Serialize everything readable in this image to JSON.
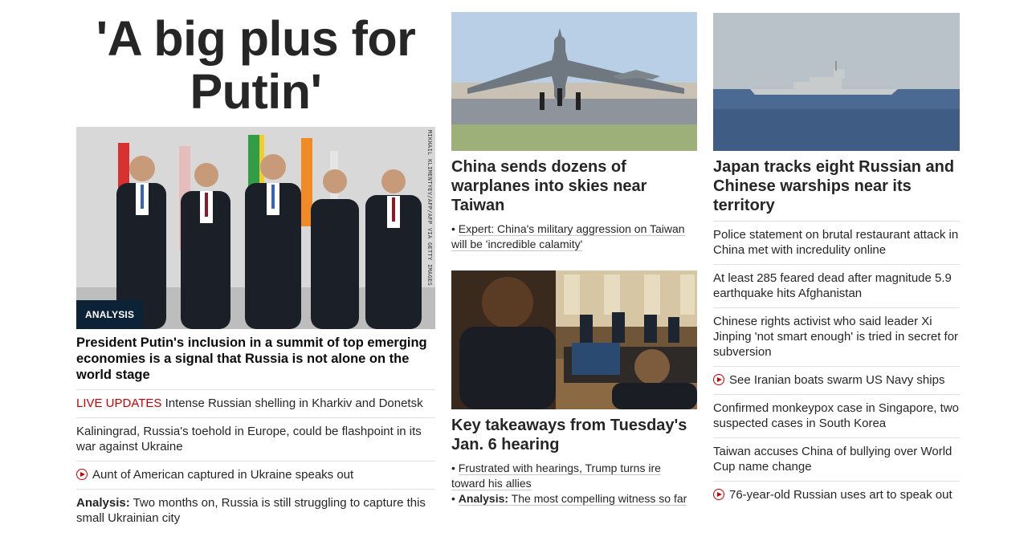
{
  "lead": {
    "headline": "'A big plus for Putin'",
    "image_credit": "MIKHAIL KLIMENTYEV/AFP/AFP VIA GETTY IMAGES",
    "badge": "ANALYSIS",
    "summary": "President Putin's inclusion in a summit of top emerging economies is a signal that Russia is not alone on the world stage"
  },
  "col1_list": [
    {
      "prefix": "LIVE UPDATES",
      "text": " Intense Russian shelling in Kharkiv and Donetsk"
    },
    {
      "text": "Kaliningrad, Russia's toehold in Europe, could be flashpoint in its war against Ukraine"
    },
    {
      "video": true,
      "text": "Aunt of American captured in Ukraine speaks out"
    },
    {
      "prefix": "Analysis:",
      "text": " Two months on, Russia is still struggling to capture this small Ukrainian city"
    }
  ],
  "col2": {
    "story1": {
      "headline": "China sends dozens of warplanes into skies near Taiwan",
      "sublinks": [
        {
          "text": "Expert: China's military aggression on Taiwan will be 'incredible calamity'"
        }
      ]
    },
    "story2": {
      "headline": "Key takeaways from Tuesday's Jan. 6 hearing",
      "sublinks": [
        {
          "text": "Frustrated with hearings, Trump turns ire toward his allies"
        },
        {
          "prefix": "Analysis:",
          "text": " The most compelling witness so far"
        }
      ]
    }
  },
  "col3": {
    "headline": "Japan tracks eight Russian and Chinese warships near its territory",
    "list": [
      {
        "text": "Police statement on brutal restaurant attack in China met with incredulity online"
      },
      {
        "text": "At least 285 feared dead after magnitude 5.9 earthquake hits Afghanistan"
      },
      {
        "text": "Chinese rights activist who said leader Xi Jinping 'not smart enough' is tried in secret for subversion"
      },
      {
        "video": true,
        "text": "See Iranian boats swarm US Navy ships"
      },
      {
        "text": "Confirmed monkeypox case in Singapore, two suspected cases in South Korea"
      },
      {
        "text": "Taiwan accuses China of bullying over World Cup name change"
      },
      {
        "video": true,
        "text": "76-year-old Russian uses art to speak out"
      }
    ]
  },
  "colors": {
    "live": "#cc0000",
    "badge_bg": "#0c2236",
    "divider": "#e2e2e2"
  }
}
